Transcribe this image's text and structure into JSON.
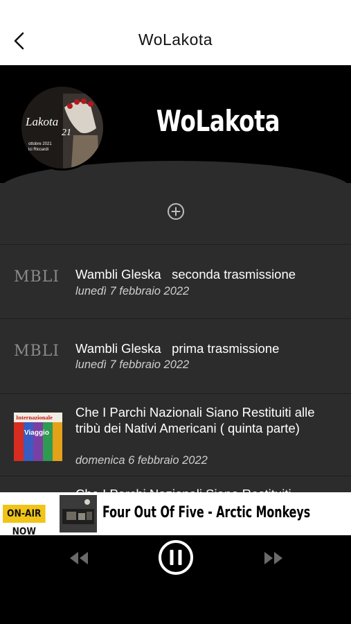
{
  "nav": {
    "title": "WoLakota",
    "back_icon": "chevron-left-icon"
  },
  "header": {
    "show_title": "WoLakota",
    "avatar_icon": "show-cover-image",
    "avatar_text": {
      "line1": "Lakota",
      "line2": "21",
      "line3": "ottobre 2021",
      "line4": "lci Riccardi"
    }
  },
  "actions": {
    "add_icon": "plus-circle-icon"
  },
  "episodes": [
    {
      "thumb_text": "MBLI",
      "title": "Wambli Gleska   seconda trasmissione",
      "date": "lunedì 7 febbraio 2022"
    },
    {
      "thumb_text": "MBLI",
      "title": "Wambli Gleska   prima trasmissione",
      "date": "lunedì 7 febbraio 2022"
    },
    {
      "thumb_text": "Internazionale",
      "thumb_text2": "Viaggio",
      "title": "Che I Parchi Nazionali Siano Restituiti alle tribù dei Nativi Americani ( quinta parte)",
      "date": "domenica 6 febbraio 2022"
    },
    {
      "title": "Che I Parchi Nazionali Siano Restituiti"
    }
  ],
  "now_playing": {
    "badge": "ON-AIR NOW",
    "song": "Four Out Of Five - Arctic Monkeys",
    "cover_icon": "album-cover-image"
  },
  "player": {
    "rewind_icon": "rewind-icon",
    "pause_icon": "pause-circle-icon",
    "forward_icon": "fast-forward-icon"
  },
  "colors": {
    "badge_bg": "#f0c419",
    "list_bg": "#2c2c2c",
    "header_bg": "#000000"
  }
}
